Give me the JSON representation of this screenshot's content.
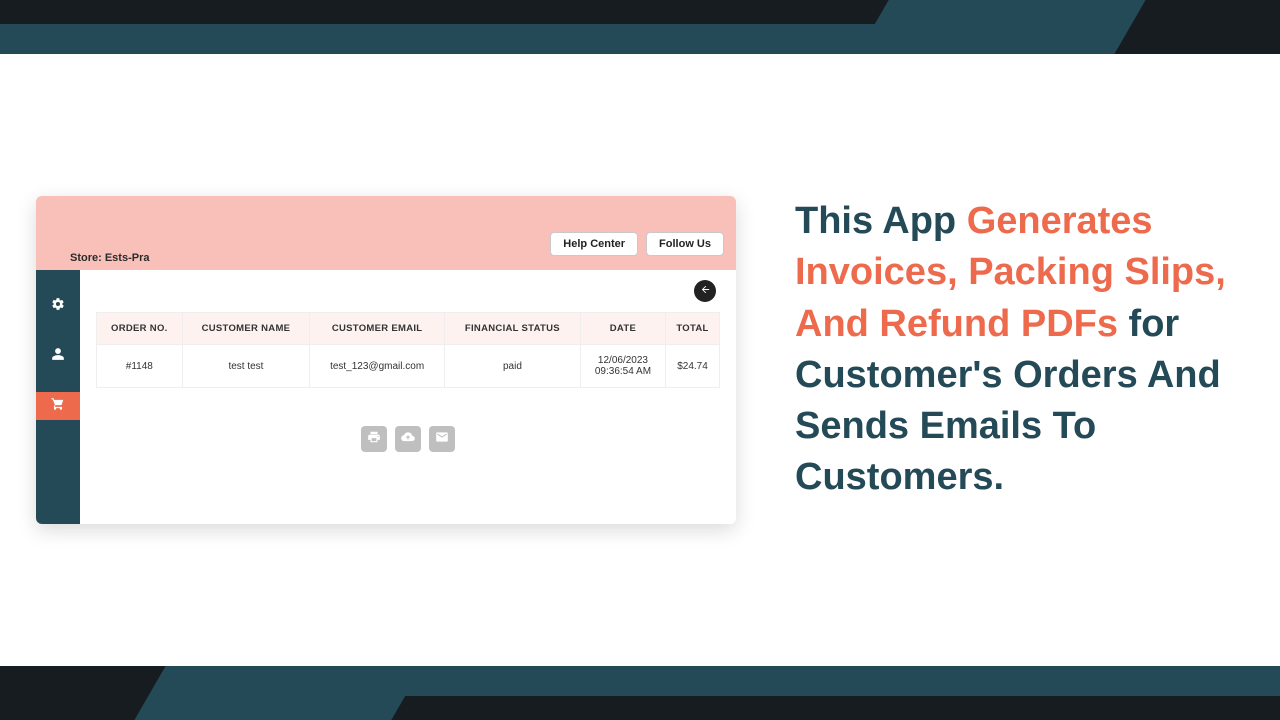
{
  "header": {
    "store_prefix": "Store: ",
    "store_name": "Ests-Pra",
    "help_center": "Help Center",
    "follow_us": "Follow Us"
  },
  "table": {
    "cols": {
      "order_no": "ORDER NO.",
      "customer_name": "CUSTOMER NAME",
      "customer_email": "CUSTOMER EMAIL",
      "financial_status": "FINANCIAL STATUS",
      "date": "DATE",
      "total": "TOTAL"
    },
    "row": {
      "order_no": "#1148",
      "customer_name": "test test",
      "customer_email": "test_123@gmail.com",
      "financial_status": "paid",
      "date_line1": "12/06/2023",
      "date_line2": "09:36:54 AM",
      "total": "$24.74"
    }
  },
  "promo": {
    "p1": "This App ",
    "hl": "Generates Invoices, Packing Slips, And Refund PDFs",
    "p2": " for Customer's Orders And Sends Emails To Customers."
  }
}
